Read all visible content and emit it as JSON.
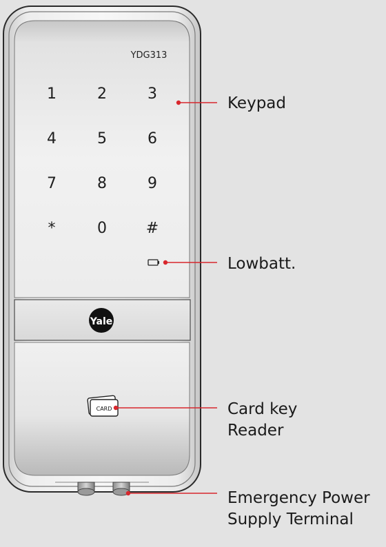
{
  "device": {
    "model": "YDG313",
    "brand_logo_text": "Yale",
    "card_text": "CARD",
    "keys": [
      "1",
      "2",
      "3",
      "4",
      "5",
      "6",
      "7",
      "8",
      "9",
      "*",
      "0",
      "#"
    ]
  },
  "callouts": {
    "keypad": "Keypad",
    "lowbatt": "Lowbatt.",
    "card_reader_line1": "Card key",
    "card_reader_line2": "Reader",
    "power_line1": "Emergency Power",
    "power_line2": "Supply Terminal"
  },
  "colors": {
    "background": "#e3e3e3",
    "callout_line": "#d8262c",
    "body_frame": "#2a2a2a",
    "logo_bg": "#111111"
  },
  "icons": {
    "battery": "battery-low-icon",
    "card": "card-icon",
    "logo": "yale-logo-icon"
  }
}
